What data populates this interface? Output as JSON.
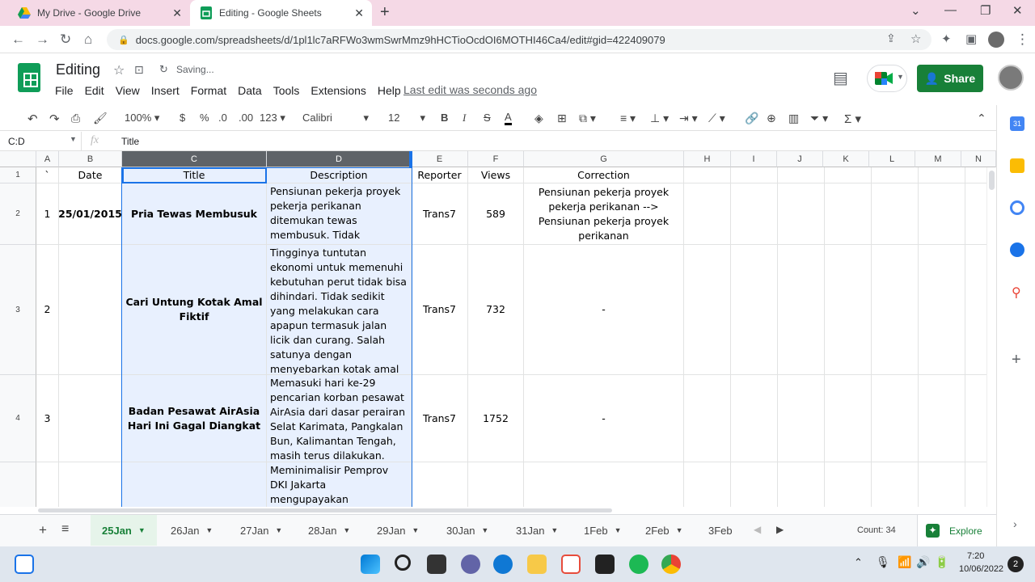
{
  "browser": {
    "tabs": [
      {
        "title": "My Drive - Google Drive",
        "active": false
      },
      {
        "title": "Editing - Google Sheets",
        "active": true
      }
    ],
    "url": "docs.google.com/spreadsheets/d/1pl1lc7aRFWo3wmSwrMmz9hHCTioOcdOI6MOTHI46Ca4/edit#gid=422409079"
  },
  "sheets": {
    "doc_title": "Editing",
    "save_status": "Saving...",
    "menu": [
      "File",
      "Edit",
      "View",
      "Insert",
      "Format",
      "Data",
      "Tools",
      "Extensions",
      "Help"
    ],
    "last_edit": "Last edit was seconds ago",
    "share_label": "Share",
    "toolbar": {
      "zoom": "100%",
      "currency": "$",
      "percent": "%",
      "dec_decrease": ".0",
      "dec_increase": ".00",
      "number_format": "123",
      "font": "Calibri",
      "font_size": "12",
      "bold": "B",
      "italic": "I",
      "strike": "S",
      "text_color": "A"
    },
    "name_box": "C:D",
    "fx": "fx",
    "formula": "Title",
    "columns": [
      "A",
      "B",
      "C",
      "D",
      "E",
      "F",
      "G",
      "H",
      "I",
      "J",
      "K",
      "L",
      "M",
      "N"
    ],
    "rows": [
      {
        "num": "1",
        "cells": [
          "`",
          "Date",
          "Title",
          "Description",
          "Reporter",
          "Views",
          "Correction"
        ]
      },
      {
        "num": "2",
        "cells": [
          "1",
          "25/01/2015",
          "Pria Tewas Membusuk",
          "Pensiunan pekerja proyek pekerja perikanan ditemukan tewas membusuk. Tidak diketahui",
          "Trans7",
          "589",
          "Pensiunan pekerja proyek pekerja perikanan --> Pensiunan pekerja proyek perikanan"
        ]
      },
      {
        "num": "3",
        "cells": [
          "2",
          "",
          "Cari Untung Kotak Amal Fiktif",
          "Tingginya tuntutan ekonomi untuk memenuhi kebutuhan perut tidak bisa dihindari. Tidak sedikit yang melakukan cara apapun termasuk jalan licik dan curang. Salah satunya dengan menyebarkan kotak amal fiktif.",
          "Trans7",
          "732",
          "-"
        ]
      },
      {
        "num": "4",
        "cells": [
          "3",
          "",
          "Badan Pesawat AirAsia Hari Ini Gagal Diangkat",
          "Memasuki hari ke-29 pencarian korban pesawat AirAsia dari dasar perairan Selat Karimata, Pangkalan Bun, Kalimantan Tengah, masih terus dilakukan.",
          "Trans7",
          "1752",
          "-"
        ]
      },
      {
        "num": "",
        "cells": [
          "",
          "",
          "",
          "Meminimalisir Pemprov DKI Jakarta mengupayakan pembersihan kali di ibukota",
          "",
          "",
          ""
        ]
      }
    ],
    "sheet_tabs": [
      "25Jan",
      "26Jan",
      "27Jan",
      "28Jan",
      "29Jan",
      "30Jan",
      "31Jan",
      "1Feb",
      "2Feb",
      "3Feb"
    ],
    "count": "Count: 34",
    "explore": "Explore"
  },
  "taskbar": {
    "time": "7:20",
    "date": "10/06/2022",
    "notif": "2"
  },
  "colors": {
    "sheets_green": "#188038",
    "selection_blue": "#1a73e8",
    "selection_fill": "#e8f0fe"
  }
}
